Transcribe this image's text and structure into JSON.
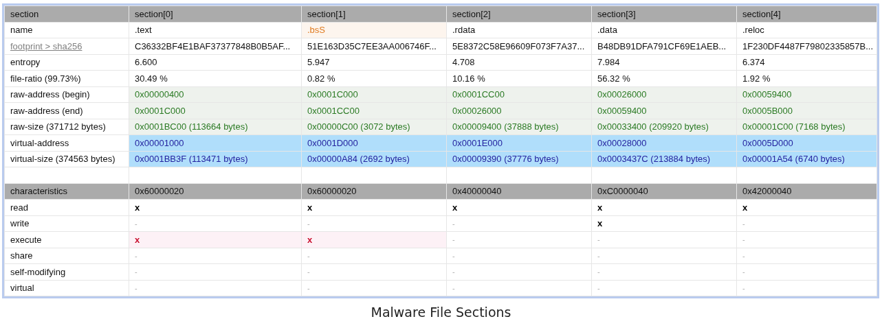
{
  "table": {
    "rows": [
      {
        "kind": "header",
        "label": "section",
        "cells": [
          "section[0]",
          "section[1]",
          "section[2]",
          "section[3]",
          "section[4]"
        ]
      },
      {
        "kind": "name",
        "label": "name",
        "cells": [
          {
            "text": ".text",
            "flagged": false
          },
          {
            "text": ".bsS",
            "flagged": true
          },
          {
            "text": ".rdata",
            "flagged": false
          },
          {
            "text": ".data",
            "flagged": false
          },
          {
            "text": ".reloc",
            "flagged": false
          }
        ]
      },
      {
        "kind": "link",
        "label": "footprint > sha256",
        "cells": [
          "C36332BF4E1BAF37377848B0B5AF...",
          "51E163D35C7EE3AA006746F...",
          "5E8372C58E96609F073F7A37...",
          "B48DB91DFA791CF69E1AEB...",
          "1F230DF4487F79802335857B..."
        ]
      },
      {
        "kind": "plain",
        "label": "entropy",
        "cells": [
          "6.600",
          "5.947",
          "4.708",
          "7.984",
          "6.374"
        ]
      },
      {
        "kind": "plain",
        "label": "file-ratio (99.73%)",
        "cells": [
          "30.49 %",
          "0.82 %",
          "10.16 %",
          "56.32 %",
          "1.92 %"
        ]
      },
      {
        "kind": "raw",
        "label": "raw-address (begin)",
        "cells": [
          "0x00000400",
          "0x0001C000",
          "0x0001CC00",
          "0x00026000",
          "0x00059400"
        ]
      },
      {
        "kind": "raw",
        "label": "raw-address (end)",
        "cells": [
          "0x0001C000",
          "0x0001CC00",
          "0x00026000",
          "0x00059400",
          "0x0005B000"
        ]
      },
      {
        "kind": "raw",
        "label": "raw-size (371712 bytes)",
        "cells": [
          "0x0001BC00 (113664 bytes)",
          "0x00000C00 (3072 bytes)",
          "0x00009400 (37888 bytes)",
          "0x00033400 (209920 bytes)",
          "0x00001C00 (7168 bytes)"
        ]
      },
      {
        "kind": "virtual",
        "label": "virtual-address",
        "cells": [
          "0x00001000",
          "0x0001D000",
          "0x0001E000",
          "0x00028000",
          "0x0005D000"
        ]
      },
      {
        "kind": "virtual",
        "label": "virtual-size (374563 bytes)",
        "cells": [
          "0x0001BB3F (113471 bytes)",
          "0x00000A84 (2692 bytes)",
          "0x00009390 (37776 bytes)",
          "0x0003437C (213884 bytes)",
          "0x00001A54 (6740 bytes)"
        ]
      },
      {
        "kind": "spacer"
      },
      {
        "kind": "header",
        "label": "characteristics",
        "cells": [
          "0x60000020",
          "0x60000020",
          "0x40000040",
          "0xC0000040",
          "0x42000040"
        ]
      },
      {
        "kind": "flags",
        "label": "read",
        "cells": [
          {
            "text": "x",
            "flagged": false
          },
          {
            "text": "x",
            "flagged": false
          },
          {
            "text": "x",
            "flagged": false
          },
          {
            "text": "x",
            "flagged": false
          },
          {
            "text": "x",
            "flagged": false
          }
        ]
      },
      {
        "kind": "flags",
        "label": "write",
        "cells": [
          {
            "text": "-",
            "flagged": false
          },
          {
            "text": "-",
            "flagged": false
          },
          {
            "text": "-",
            "flagged": false
          },
          {
            "text": "x",
            "flagged": false
          },
          {
            "text": "-",
            "flagged": false
          }
        ]
      },
      {
        "kind": "flags",
        "label": "execute",
        "cells": [
          {
            "text": "x",
            "flagged": true
          },
          {
            "text": "x",
            "flagged": true
          },
          {
            "text": "-",
            "flagged": false
          },
          {
            "text": "-",
            "flagged": false
          },
          {
            "text": "-",
            "flagged": false
          }
        ]
      },
      {
        "kind": "flags",
        "label": "share",
        "cells": [
          {
            "text": "-",
            "flagged": false
          },
          {
            "text": "-",
            "flagged": false
          },
          {
            "text": "-",
            "flagged": false
          },
          {
            "text": "-",
            "flagged": false
          },
          {
            "text": "-",
            "flagged": false
          }
        ]
      },
      {
        "kind": "flags",
        "label": "self-modifying",
        "cells": [
          {
            "text": "-",
            "flagged": false
          },
          {
            "text": "-",
            "flagged": false
          },
          {
            "text": "-",
            "flagged": false
          },
          {
            "text": "-",
            "flagged": false
          },
          {
            "text": "-",
            "flagged": false
          }
        ]
      },
      {
        "kind": "flags",
        "label": "virtual",
        "cells": [
          {
            "text": "-",
            "flagged": false
          },
          {
            "text": "-",
            "flagged": false
          },
          {
            "text": "-",
            "flagged": false
          },
          {
            "text": "-",
            "flagged": false
          },
          {
            "text": "-",
            "flagged": false
          }
        ]
      }
    ]
  },
  "caption": "Malware File Sections"
}
